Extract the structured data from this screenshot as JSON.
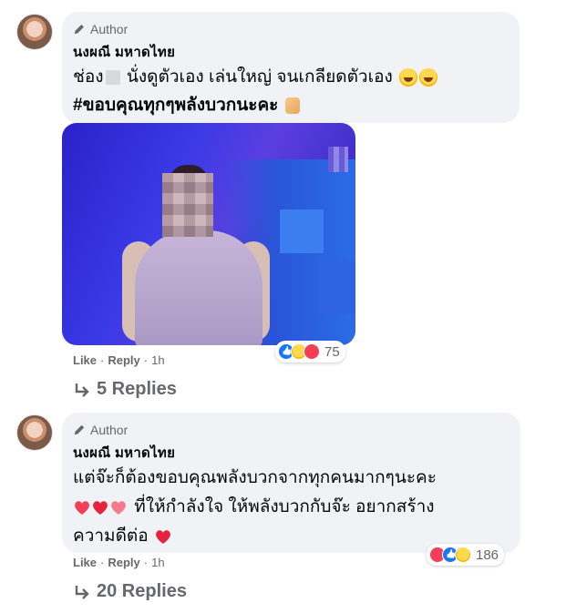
{
  "comments": [
    {
      "author_badge": "Author",
      "name": "นงผณี มหาดไทย",
      "text_before_blur": "ช่อง",
      "text_after_blur": " นั่งดูตัวเอง เล่นใหญ่ จนเกลียดตัวเอง",
      "hashtag": "#ขอบคุณทุกๆพลังบวกนะคะ",
      "actions": {
        "like": "Like",
        "reply": "Reply",
        "time": "1h"
      },
      "reaction_count": "75",
      "replies_label": "5 Replies"
    },
    {
      "author_badge": "Author",
      "name": "นงผณี มหาดไทย",
      "line1": "แต่จ๊ะก็ต้องขอบคุณพลังบวกจากทุกคนมากๆนะคะ",
      "line2": " ที่ให้กำลังใจ ให้พลังบวกกับจ๊ะ อยากสร้าง",
      "line3": "ความดีต่อ",
      "actions": {
        "like": "Like",
        "reply": "Reply",
        "time": "1h"
      },
      "reaction_count": "186",
      "replies_label": "20 Replies"
    }
  ],
  "icons": {
    "author_badge": "pen-icon",
    "replies": "reply-arrow-icon",
    "reactions_1": [
      "like-icon",
      "haha-icon",
      "love-icon"
    ],
    "reactions_2": [
      "love-icon",
      "like-icon",
      "care-icon"
    ]
  },
  "colors": {
    "bubble": "#f0f2f5",
    "meta": "#65676b",
    "like_blue": "#1877f2",
    "love_red": "#f33e58"
  }
}
